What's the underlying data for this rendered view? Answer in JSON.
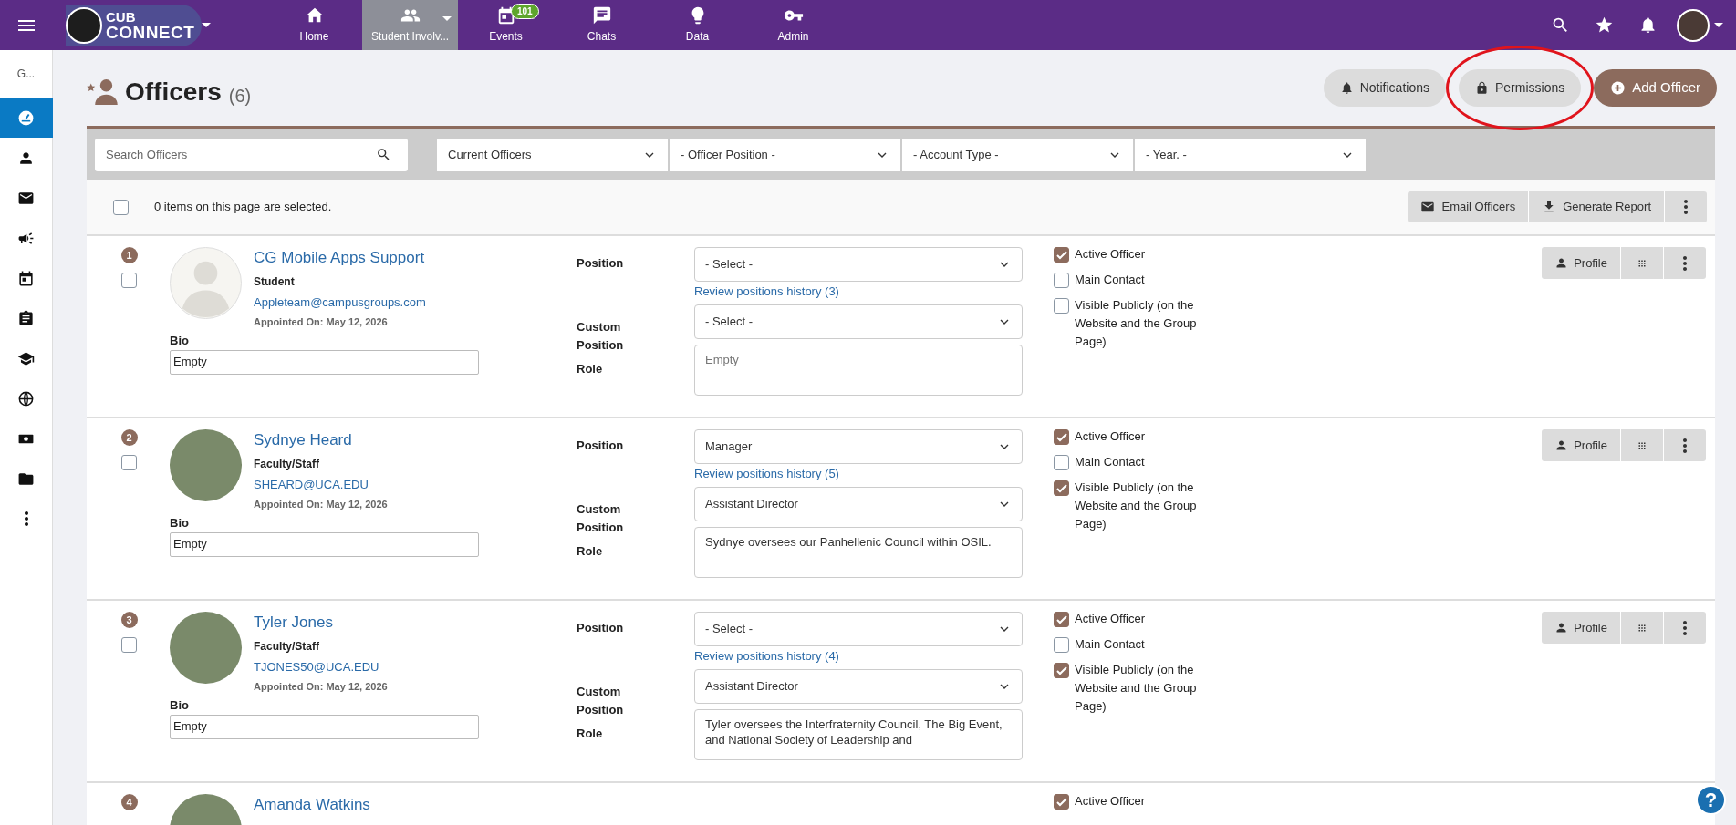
{
  "topbar": {
    "logo": {
      "line_1": "CUB",
      "line_2": "CONNECT"
    },
    "nav": [
      {
        "label": "Home",
        "selected": false,
        "dropdown": false
      },
      {
        "label": "Student Involv...",
        "selected": true,
        "dropdown": true
      },
      {
        "label": "Events",
        "selected": false,
        "dropdown": false,
        "badge": "101"
      },
      {
        "label": "Chats",
        "selected": false,
        "dropdown": false
      },
      {
        "label": "Data",
        "selected": false,
        "dropdown": false
      },
      {
        "label": "Admin",
        "selected": false,
        "dropdown": false
      }
    ]
  },
  "sidebar": {
    "group_label": "G...",
    "items": [
      {
        "selected": true
      },
      {
        "selected": false
      },
      {
        "selected": false
      },
      {
        "selected": false
      },
      {
        "selected": false
      },
      {
        "selected": false
      },
      {
        "selected": false
      },
      {
        "selected": false
      },
      {
        "selected": false
      },
      {
        "selected": false
      },
      {
        "selected": false
      }
    ]
  },
  "header": {
    "title": "Officers",
    "count": "(6)",
    "buttons": [
      {
        "label": "Notifications",
        "kind": "bell"
      },
      {
        "label": "Permissions",
        "kind": "lock",
        "circled": true
      },
      {
        "label": "Add Officer",
        "kind": "add"
      }
    ]
  },
  "filters": {
    "search": {
      "placeholder": "Search Officers"
    },
    "selects": [
      "Current Officers",
      "- Officer Position -",
      "- Account Type -",
      "- Year. -"
    ]
  },
  "selection": {
    "checked": false,
    "text": "0 items on this page are selected.",
    "actions": [
      "Email Officers",
      "Generate Report"
    ]
  },
  "officers": [
    {
      "number": "1",
      "checked": false,
      "kind": "silhouette",
      "name": "CG Mobile Apps Support",
      "type": "Student",
      "email": "Appleteam@campusgroups.com",
      "appointed": "Appointed On: May 12, 2026",
      "bio_label": "Bio",
      "bio": "Empty",
      "position_label": "Position",
      "position": "- Select -",
      "history": "Review positions history (3)",
      "custom_label": "Custom Position",
      "custom_position": "- Select -",
      "role_label": "Role",
      "role": {
        "placeholder": "Empty"
      },
      "checkboxes": [
        {
          "label": "Active Officer",
          "checked": true
        },
        {
          "label": "Main Contact",
          "checked": false
        },
        {
          "label": "Visible Publicly (on the Website and the Group Page)",
          "checked": false
        }
      ],
      "profile": "Profile"
    },
    {
      "number": "2",
      "checked": false,
      "kind": "photo",
      "name": "Sydnye Heard",
      "type": "Faculty/Staff",
      "email": "SHEARD@UCA.EDU",
      "appointed": "Appointed On: May 12, 2026",
      "bio_label": "Bio",
      "bio": "Empty",
      "position_label": "Position",
      "position": "Manager",
      "history": "Review positions history (5)",
      "custom_label": "Custom Position",
      "custom_position": "Assistant Director",
      "role_label": "Role",
      "role": {
        "value": "Sydnye oversees our Panhellenic Council within OSIL."
      },
      "checkboxes": [
        {
          "label": "Active Officer",
          "checked": true
        },
        {
          "label": "Main Contact",
          "checked": false
        },
        {
          "label": "Visible Publicly (on the Website and the Group Page)",
          "checked": true
        }
      ],
      "profile": "Profile"
    },
    {
      "number": "3",
      "checked": false,
      "kind": "photo",
      "name": "Tyler Jones",
      "type": "Faculty/Staff",
      "email": "TJONES50@UCA.EDU",
      "appointed": "Appointed On: May 12, 2026",
      "bio_label": "Bio",
      "bio": "Empty",
      "position_label": "Position",
      "position": "- Select -",
      "history": "Review positions history (4)",
      "custom_label": "Custom Position",
      "custom_position": "Assistant Director",
      "role_label": "Role",
      "role": {
        "value": "Tyler oversees the Interfraternity Council, The Big Event, and National Society of Leadership and"
      },
      "checkboxes": [
        {
          "label": "Active Officer",
          "checked": true
        },
        {
          "label": "Main Contact",
          "checked": false
        },
        {
          "label": "Visible Publicly (on the Website and the Group Page)",
          "checked": true
        }
      ],
      "profile": "Profile"
    },
    {
      "number": "4",
      "kind": "photo",
      "name": "Amanda Watkins",
      "checkboxes": [
        {
          "label": "Active Officer",
          "checked": true
        }
      ]
    }
  ],
  "help_button": "?"
}
